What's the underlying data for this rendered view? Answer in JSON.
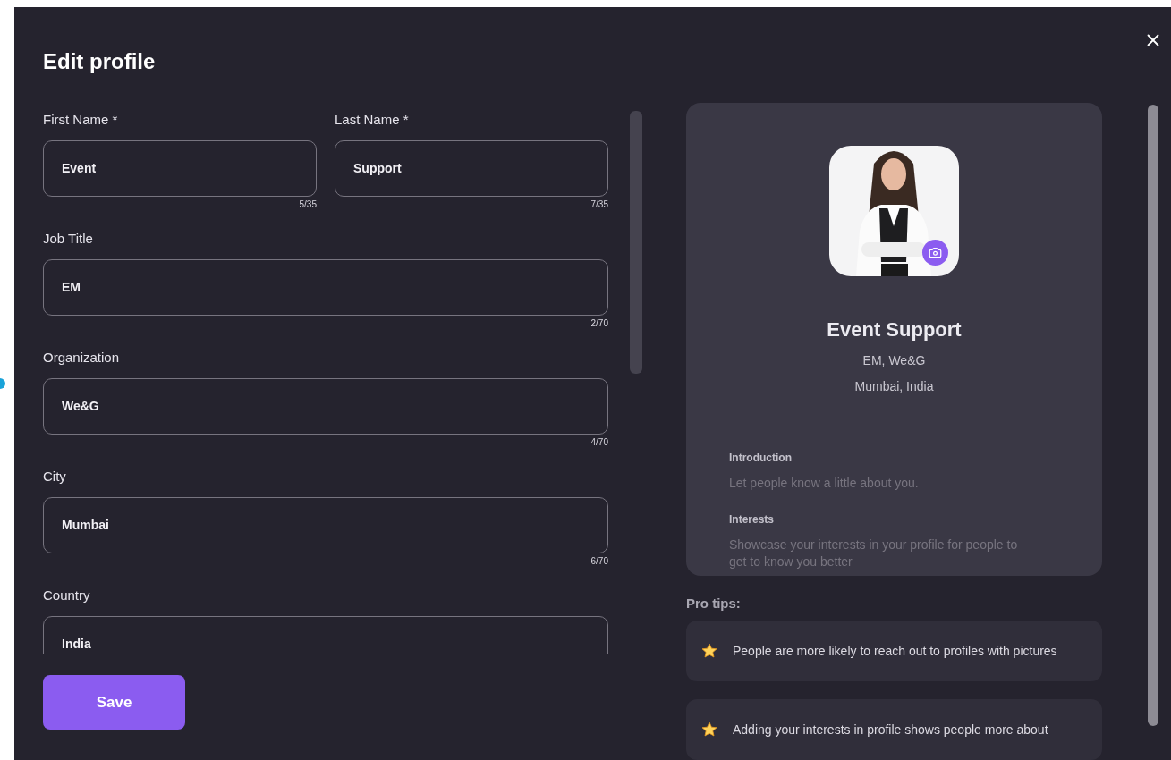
{
  "dialog": {
    "title": "Edit profile"
  },
  "name_fields": [
    {
      "label": "First Name *",
      "value": "Event",
      "counter": "5/35"
    },
    {
      "label": "Last Name *",
      "value": "Support",
      "counter": "7/35"
    }
  ],
  "fields": [
    {
      "label": "Job Title",
      "value": "EM",
      "counter": "2/70"
    },
    {
      "label": "Organization",
      "value": "We&G",
      "counter": "4/70"
    },
    {
      "label": "City",
      "value": "Mumbai",
      "counter": "6/70"
    },
    {
      "label": "Country",
      "value": "India"
    }
  ],
  "save_button": "Save",
  "preview": {
    "name": "Event Support",
    "headline": "EM, We&G",
    "location": "Mumbai, India",
    "sections": [
      {
        "heading": "Introduction",
        "placeholder": "Let people know a little about you."
      },
      {
        "heading": "Interests",
        "placeholder": "Showcase your interests in your profile for people to get to know you better"
      }
    ]
  },
  "pro_tips": {
    "title": "Pro tips:",
    "tips": [
      "People are more likely to reach out to profiles with pictures",
      "Adding your interests in profile shows people more about"
    ]
  }
}
